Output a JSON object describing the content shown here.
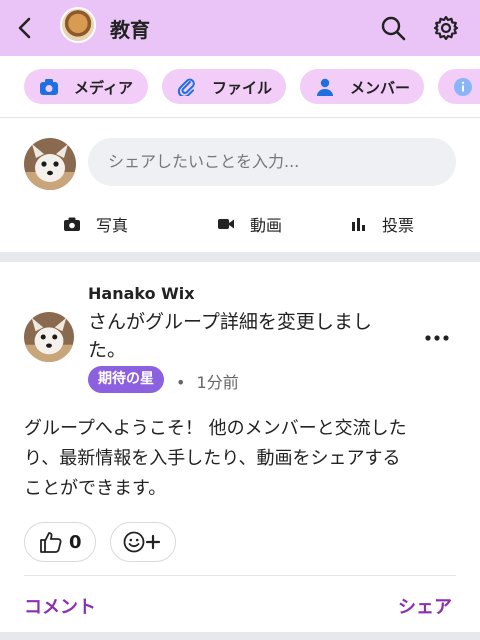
{
  "header": {
    "title": "教育",
    "back_icon": "chevron-left-icon",
    "search_icon": "search-icon",
    "settings_icon": "gear-icon",
    "bg_color": "#eac4f7"
  },
  "chips": [
    {
      "label": "メディア",
      "icon": "camera-icon"
    },
    {
      "label": "ファイル",
      "icon": "paperclip-icon"
    },
    {
      "label": "メンバー",
      "icon": "person-icon"
    },
    {
      "label": "",
      "icon": "info-icon"
    }
  ],
  "composer": {
    "placeholder": "シェアしたいことを入力..."
  },
  "actions": {
    "photo": "写真",
    "video": "動画",
    "poll": "投票"
  },
  "post": {
    "author": "Hanako Wix",
    "action_line1": "さんがグループ詳細を変更しまし",
    "action_line2": "た。",
    "badge": "期待の星",
    "separator": "•",
    "time": "1分前",
    "body_line1": "グループへようこそ！ 他のメンバーと交流した",
    "body_line2": "り、最新情報を入手したり、動画をシェアする",
    "body_line3": "ことができます。",
    "like_count": "0",
    "comment_label": "コメント",
    "share_label": "シェア"
  },
  "colors": {
    "accent": "#8b2fb2",
    "badge": "#8c61e0",
    "chip": "#f1cdf8",
    "icon_blue": "#1e6fe0"
  }
}
